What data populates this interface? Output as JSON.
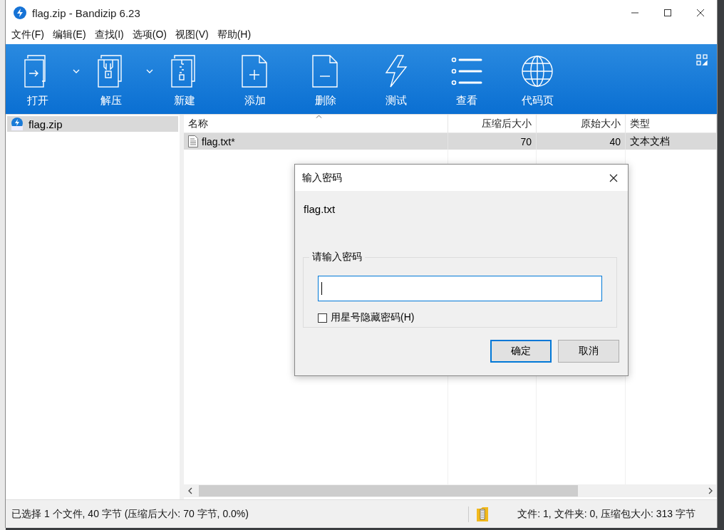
{
  "window": {
    "title": "flag.zip - Bandizip 6.23"
  },
  "menu": [
    "文件(F)",
    "编辑(E)",
    "查找(I)",
    "选项(O)",
    "视图(V)",
    "帮助(H)"
  ],
  "toolbar": [
    {
      "label": "打开",
      "has_menu": true
    },
    {
      "label": "解压",
      "has_menu": true
    },
    {
      "label": "新建",
      "has_menu": false
    },
    {
      "label": "添加",
      "has_menu": false
    },
    {
      "label": "删除",
      "has_menu": false
    },
    {
      "label": "测试",
      "has_menu": false
    },
    {
      "label": "查看",
      "has_menu": false
    },
    {
      "label": "代码页",
      "has_menu": false
    }
  ],
  "sidebar": {
    "items": [
      {
        "label": "flag.zip",
        "selected": true
      }
    ]
  },
  "table": {
    "columns": [
      {
        "label": "名称",
        "sorted": true
      },
      {
        "label": "压缩后大小",
        "sorted": false
      },
      {
        "label": "原始大小",
        "sorted": false
      },
      {
        "label": "类型",
        "sorted": false
      }
    ],
    "rows": [
      {
        "cells": [
          "flag.txt*",
          "70",
          "40",
          "文本文档"
        ],
        "selected": true
      }
    ]
  },
  "dialog": {
    "title": "输入密码",
    "filename": "flag.txt",
    "group_label": "请输入密码",
    "password": {
      "focused": true
    },
    "checkbox": {
      "label": "用星号隐藏密码(H)",
      "checked": false
    },
    "buttons": [
      {
        "label": "确定",
        "default": true
      },
      {
        "label": "取消",
        "default": false
      }
    ]
  },
  "status_bar": {
    "selection": "已选择 1 个文件, 40 字节 (压缩后大小: 70 字节, 0.0%)",
    "summary": "文件: 1, 文件夹: 0, 压缩包大小: 313 字节"
  }
}
